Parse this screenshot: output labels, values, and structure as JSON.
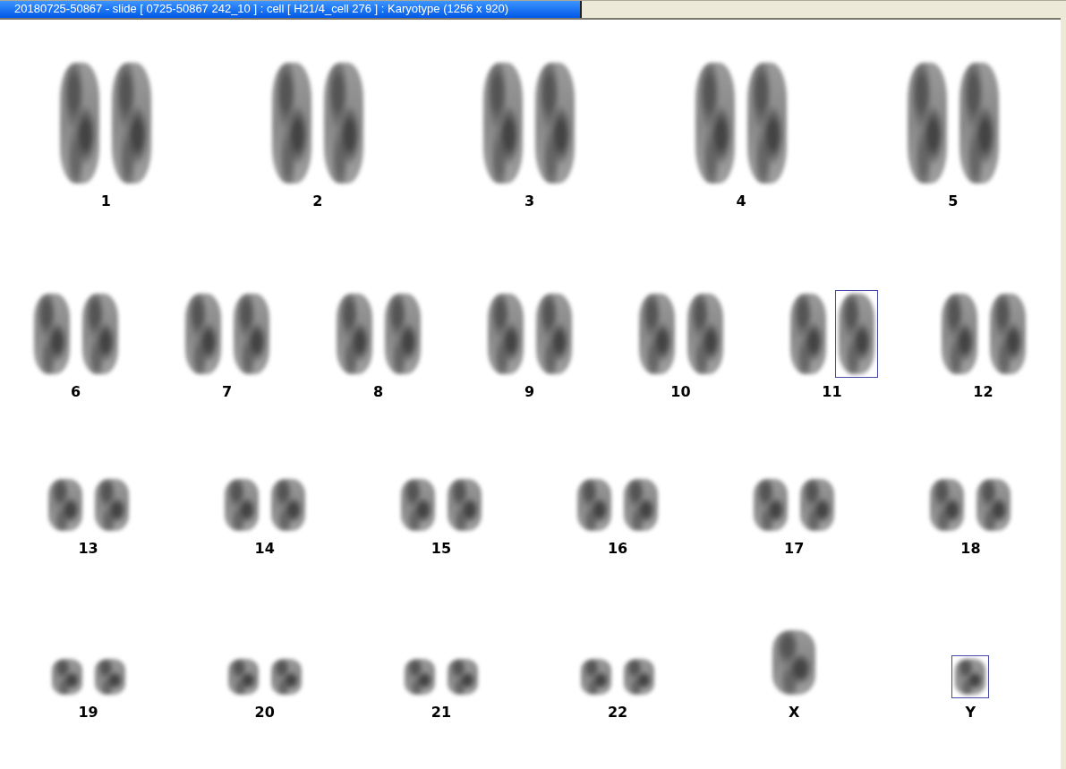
{
  "window": {
    "title": "20180725-50867 - slide [ 0725-50867 242_10 ] : cell [ H21/4_cell 276 ] : Karyotype  (1256 x 920)"
  },
  "rows": [
    {
      "groups": [
        {
          "label": "1",
          "chromosomes": [
            {
              "selected": false
            },
            {
              "selected": false
            }
          ]
        },
        {
          "label": "2",
          "chromosomes": [
            {
              "selected": false
            },
            {
              "selected": false
            }
          ]
        },
        {
          "label": "3",
          "chromosomes": [
            {
              "selected": false
            },
            {
              "selected": false
            }
          ]
        },
        {
          "label": "4",
          "chromosomes": [
            {
              "selected": false
            },
            {
              "selected": false
            }
          ]
        },
        {
          "label": "5",
          "chromosomes": [
            {
              "selected": false
            },
            {
              "selected": false
            }
          ]
        }
      ]
    },
    {
      "groups": [
        {
          "label": "6",
          "chromosomes": [
            {
              "selected": false
            },
            {
              "selected": false
            }
          ]
        },
        {
          "label": "7",
          "chromosomes": [
            {
              "selected": false
            },
            {
              "selected": false
            }
          ]
        },
        {
          "label": "8",
          "chromosomes": [
            {
              "selected": false
            },
            {
              "selected": false
            }
          ]
        },
        {
          "label": "9",
          "chromosomes": [
            {
              "selected": false
            },
            {
              "selected": false
            }
          ]
        },
        {
          "label": "10",
          "chromosomes": [
            {
              "selected": false
            },
            {
              "selected": false
            }
          ]
        },
        {
          "label": "11",
          "chromosomes": [
            {
              "selected": false
            },
            {
              "selected": true
            }
          ]
        },
        {
          "label": "12",
          "chromosomes": [
            {
              "selected": false
            },
            {
              "selected": false
            }
          ]
        }
      ]
    },
    {
      "groups": [
        {
          "label": "13",
          "chromosomes": [
            {
              "selected": false
            },
            {
              "selected": false
            }
          ]
        },
        {
          "label": "14",
          "chromosomes": [
            {
              "selected": false
            },
            {
              "selected": false
            }
          ]
        },
        {
          "label": "15",
          "chromosomes": [
            {
              "selected": false
            },
            {
              "selected": false
            }
          ]
        },
        {
          "label": "16",
          "chromosomes": [
            {
              "selected": false
            },
            {
              "selected": false
            }
          ]
        },
        {
          "label": "17",
          "chromosomes": [
            {
              "selected": false
            },
            {
              "selected": false
            }
          ]
        },
        {
          "label": "18",
          "chromosomes": [
            {
              "selected": false
            },
            {
              "selected": false
            }
          ]
        }
      ]
    },
    {
      "groups": [
        {
          "label": "19",
          "chromosomes": [
            {
              "selected": false
            },
            {
              "selected": false
            }
          ]
        },
        {
          "label": "20",
          "chromosomes": [
            {
              "selected": false
            },
            {
              "selected": false
            }
          ]
        },
        {
          "label": "21",
          "chromosomes": [
            {
              "selected": false
            },
            {
              "selected": false
            }
          ]
        },
        {
          "label": "22",
          "chromosomes": [
            {
              "selected": false
            },
            {
              "selected": false
            }
          ]
        },
        {
          "label": "X",
          "chromosomes": [
            {
              "selected": false
            }
          ]
        },
        {
          "label": "Y",
          "chromosomes": [
            {
              "selected": true
            }
          ]
        }
      ]
    }
  ]
}
